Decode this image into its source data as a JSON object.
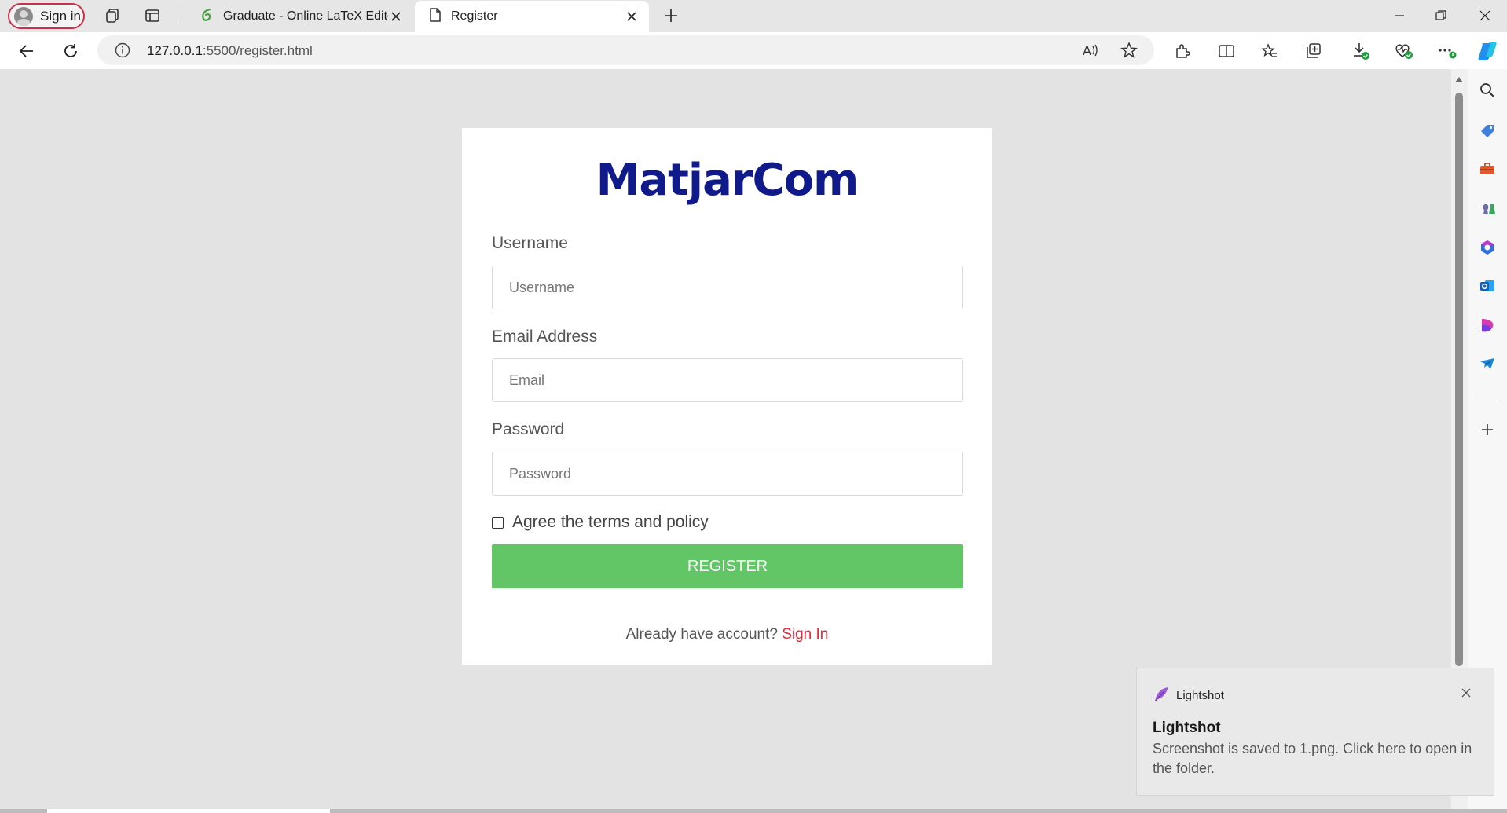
{
  "browser": {
    "profile_label": "Sign in",
    "tabs": [
      {
        "title": "Graduate - Online LaTeX Editor O",
        "active": false
      },
      {
        "title": "Register",
        "active": true
      }
    ],
    "url_host": "127.0.0.1",
    "url_path": ":5500/register.html"
  },
  "sidebar": {
    "items": [
      "search-icon",
      "shopping-tag-icon",
      "toolbox-icon",
      "games-icon",
      "microsoft-365-icon",
      "outlook-icon",
      "designer-icon",
      "telegram-icon"
    ]
  },
  "form": {
    "brand": "MatjarCom",
    "username_label": "Username",
    "username_placeholder": "Username",
    "email_label": "Email Address",
    "email_placeholder": "Email",
    "password_label": "Password",
    "password_placeholder": "Password",
    "agree_label": "Agree the terms and policy",
    "agree_checked": false,
    "register_label": "REGISTER",
    "signin_prompt": "Already have account?",
    "signin_link": "Sign In"
  },
  "toast": {
    "app_name": "Lightshot",
    "title": "Lightshot",
    "message": "Screenshot is saved to 1.png. Click here to open in the folder."
  },
  "colors": {
    "brand": "#101a8a",
    "register_button": "#62c666",
    "signin_link": "#e8243a",
    "profile_border": "#c4314b"
  }
}
